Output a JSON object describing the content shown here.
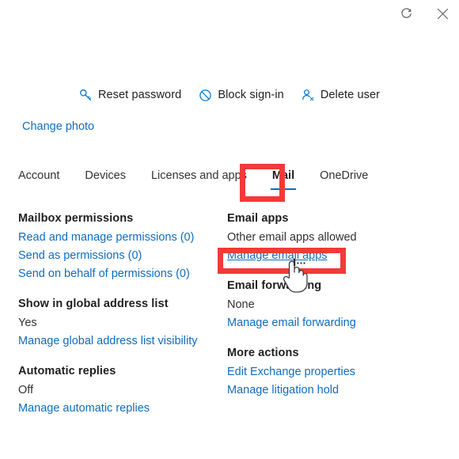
{
  "window": {
    "icons": [
      {
        "name": "refresh-icon",
        "label": "Refresh"
      },
      {
        "name": "close-icon",
        "label": "Close"
      }
    ]
  },
  "command_bar": {
    "items": [
      {
        "icon": "key-icon",
        "label": "Reset password"
      },
      {
        "icon": "block-icon",
        "label": "Block sign-in"
      },
      {
        "icon": "delete-user-icon",
        "label": "Delete user"
      }
    ]
  },
  "change_photo": {
    "label": "Change photo"
  },
  "tabs": [
    {
      "label": "Account",
      "selected": false
    },
    {
      "label": "Devices",
      "selected": false
    },
    {
      "label": "Licenses and apps",
      "selected": false
    },
    {
      "label": "Mail",
      "selected": true
    },
    {
      "label": "OneDrive",
      "selected": false
    }
  ],
  "left_column": {
    "mailbox_permissions": {
      "title": "Mailbox permissions",
      "links": [
        "Read and manage permissions (0)",
        "Send as permissions (0)",
        "Send on behalf of permissions (0)"
      ]
    },
    "global_address_list": {
      "title": "Show in global address list",
      "value": "Yes",
      "link": "Manage global address list visibility"
    },
    "automatic_replies": {
      "title": "Automatic replies",
      "value": "Off",
      "link": "Manage automatic replies"
    }
  },
  "right_column": {
    "email_apps": {
      "title": "Email apps",
      "value": "Other email apps allowed",
      "link": "Manage email apps"
    },
    "email_forwarding": {
      "title": "Email forwarding",
      "value": "None",
      "link": "Manage email forwarding"
    },
    "more_actions": {
      "title": "More actions",
      "links": [
        "Edit Exchange properties",
        "Manage litigation hold"
      ]
    }
  },
  "annotations": {
    "color": "#f23a3a",
    "highlighted": [
      "Mail",
      "Manage email apps"
    ]
  },
  "colors": {
    "link": "#0f6cbd",
    "accent": "#0078d4",
    "text": "#323130",
    "annotation": "#f23a3a"
  }
}
